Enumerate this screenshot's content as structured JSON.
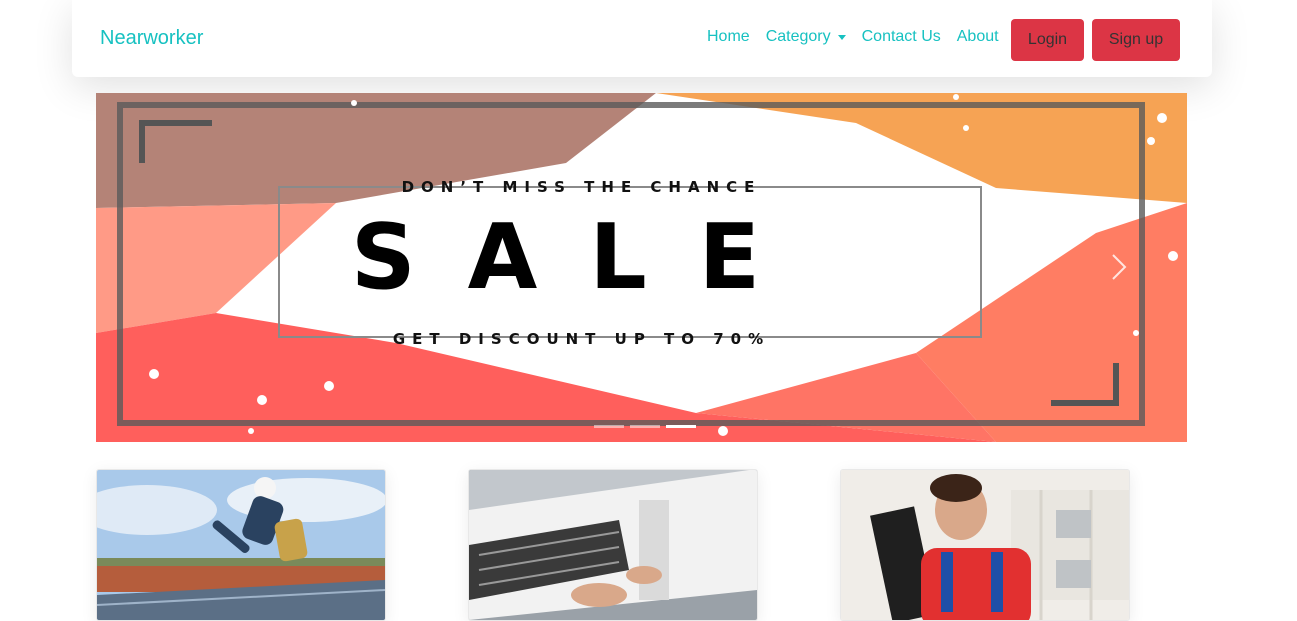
{
  "navbar": {
    "brand": "Nearworker",
    "links": [
      {
        "label": "Home"
      },
      {
        "label": "Category"
      },
      {
        "label": "Contact Us"
      },
      {
        "label": "About"
      }
    ],
    "login_label": "Login",
    "signup_label": "Sign up"
  },
  "carousel": {
    "slide": {
      "top_text": "DON’T MISS THE CHANCE",
      "main_text": "SALE",
      "bottom_text": "GET DISCOUNT UP TO 70%"
    },
    "indicator_count": 3,
    "active_indicator": 3
  },
  "cards": [
    {
      "image": "worker-on-roof-solar-panels"
    },
    {
      "image": "air-conditioner-repair"
    },
    {
      "image": "technician-repairing-tv"
    }
  ],
  "colors": {
    "brand": "#17c1c1",
    "button": "#dc3545",
    "sale_orange": "#f5a04a",
    "sale_red": "#f55e5a"
  }
}
